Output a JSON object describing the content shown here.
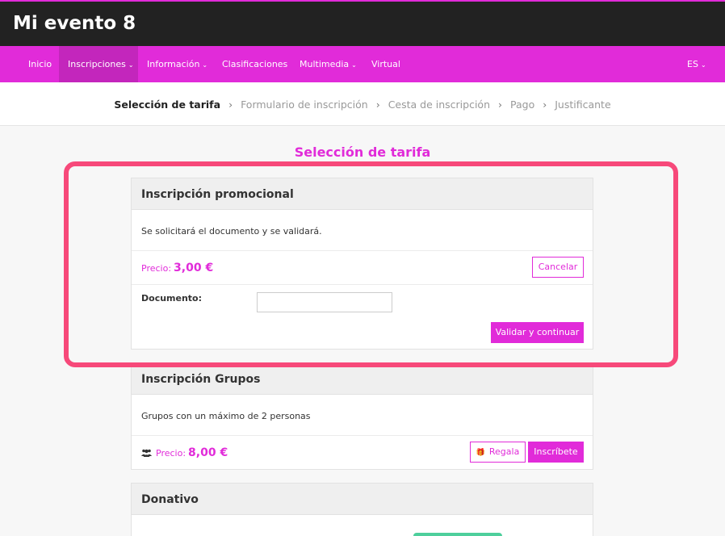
{
  "app": {
    "title": "Mi evento 8"
  },
  "nav": {
    "items": [
      {
        "label": "Inicio"
      },
      {
        "label": "Inscripciones"
      },
      {
        "label": "Información"
      },
      {
        "label": "Clasificaciones"
      },
      {
        "label": "Multimedia"
      },
      {
        "label": "Virtual"
      }
    ],
    "lang": "ES"
  },
  "steps": [
    "Selección de tarifa",
    "Formulario de inscripción",
    "Cesta de inscripción",
    "Pago",
    "Justificante"
  ],
  "section_title": "Selección de tarifa",
  "cards": [
    {
      "title": "Inscripción promocional",
      "description": "Se solicitará el documento y se validará.",
      "price_label": "Precio:",
      "price": "3,00 €",
      "cancel_label": "Cancelar",
      "document_label": "Documento:",
      "document_value": "",
      "validate_label": "Validar y continuar"
    },
    {
      "title": "Inscripción Grupos",
      "description": "Grupos con un máximo de 2 personas",
      "price_label": "Precio:",
      "price": "8,00 €",
      "gift_label": "Regala",
      "signup_label": "Inscríbete"
    },
    {
      "title": "Donativo"
    }
  ],
  "colors": {
    "accent": "#e12bd9",
    "topbar": "#222222",
    "highlight": "#f7497a"
  }
}
